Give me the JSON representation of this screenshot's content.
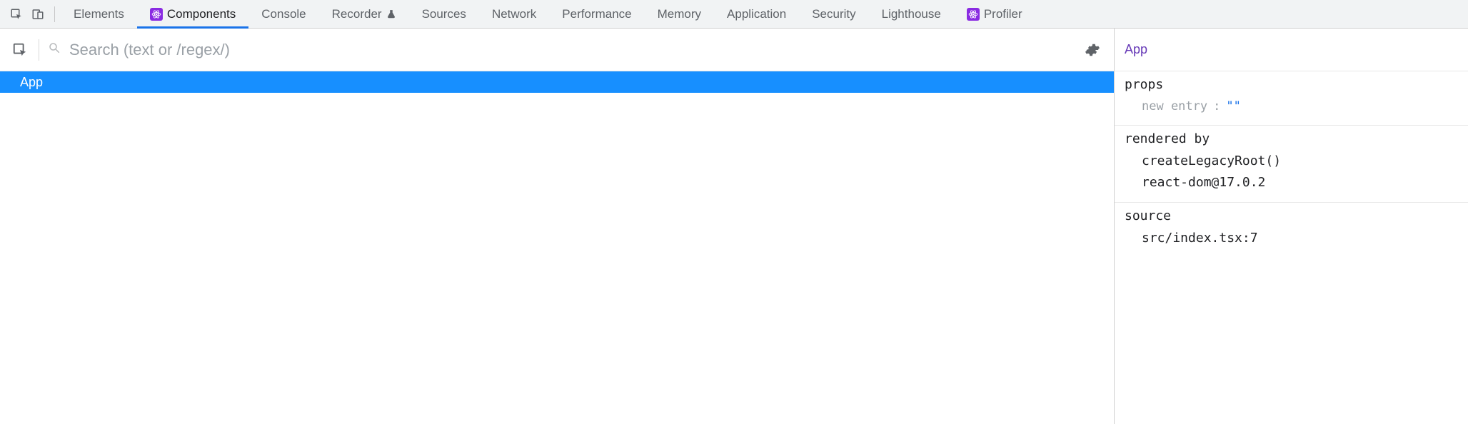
{
  "tabs": {
    "elements": "Elements",
    "components": "Components",
    "console": "Console",
    "recorder": "Recorder",
    "sources": "Sources",
    "network": "Network",
    "performance": "Performance",
    "memory": "Memory",
    "application": "Application",
    "security": "Security",
    "lighthouse": "Lighthouse",
    "profiler": "Profiler"
  },
  "search": {
    "placeholder": "Search (text or /regex/)",
    "value": ""
  },
  "tree": {
    "items": [
      {
        "label": "App",
        "selected": true
      }
    ]
  },
  "details": {
    "component_name": "App",
    "sections": {
      "props": {
        "title": "props",
        "entries": [
          {
            "key": "new entry",
            "value": "\"\""
          }
        ]
      },
      "rendered_by": {
        "title": "rendered by",
        "lines": [
          "createLegacyRoot()",
          "react-dom@17.0.2"
        ]
      },
      "source": {
        "title": "source",
        "lines": [
          "src/index.tsx:7"
        ]
      }
    }
  }
}
